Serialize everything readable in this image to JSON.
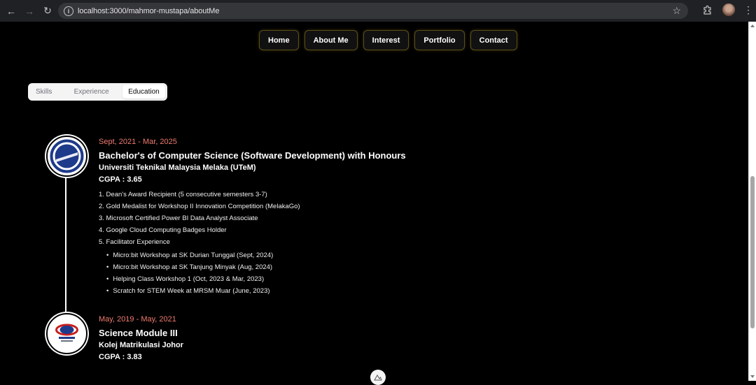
{
  "browser": {
    "url": "localhost:3000/mahmor-mustapa/aboutMe"
  },
  "nav": {
    "items": [
      "Home",
      "About Me",
      "Interest",
      "Portfolio",
      "Contact"
    ]
  },
  "tabs": {
    "items": [
      "Skills",
      "Experience",
      "Education"
    ],
    "active": "Education"
  },
  "education": [
    {
      "date": "Sept, 2021 - Mar, 2025",
      "degree": "Bachelor's of Computer Science (Software Development) with Honours",
      "school": "Universiti Teknikal Malaysia Melaka (UTeM)",
      "cgpa": "CGPA : 3.65",
      "achievements": [
        "1. Dean's Award Recipient (5 consecutive semesters 3-7)",
        "2. Gold Medalist for Workshop II Innovation Competition (MelakaGo)",
        "3. Microsoft Certified Power BI Data Analyst Associate",
        "4. Google Cloud Computing Badges Holder",
        "5. Facilitator Experience"
      ],
      "facilitator": [
        "Micro:bit Workshop at SK Durian Tunggal (Sept, 2024)",
        "Micro:bit Workshop at SK Tanjung Minyak (Aug, 2024)",
        "Helping Class Workshop 1 (Oct, 2023 & Mar, 2023)",
        "Scratch for STEM Week at MRSM Muar (June, 2023)"
      ]
    },
    {
      "date": "May, 2019 - May, 2021",
      "degree": "Science Module III",
      "school": "Kolej Matrikulasi Johor",
      "cgpa": "CGPA : 3.83"
    }
  ],
  "colors": {
    "date": "#ef7b6f",
    "nav_border": "#5c4f18"
  }
}
